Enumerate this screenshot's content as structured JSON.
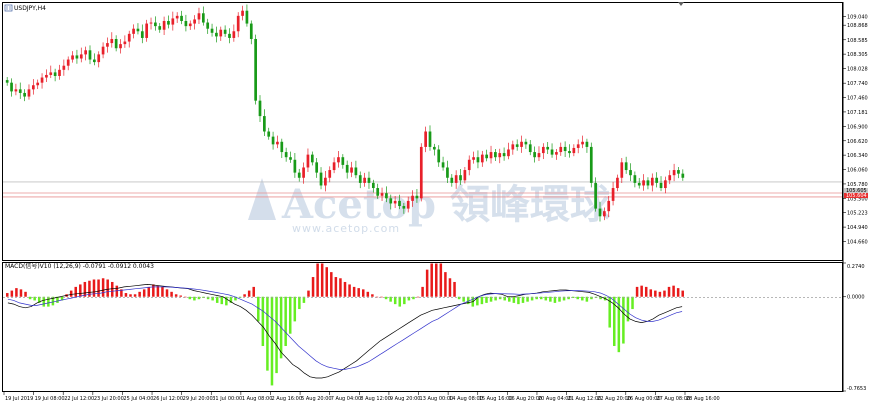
{
  "symbol_label": "USDJPY,H4",
  "macd_label": "MACD(信号)V10 (12,26,9) -0.0791 -0.0912 0.0043",
  "watermark": {
    "brand": "Acetop",
    "cjk": "領峰環球",
    "site": "www.acetop.com"
  },
  "colors": {
    "bull": "#e8202a",
    "bear": "#189a18",
    "hist_pos": "#e81a1a",
    "hist_neg": "#66ee22",
    "macd_line": "#000000",
    "signal_line": "#3333cc",
    "hline": "#e89090",
    "ask_line": "#c0c0c0"
  },
  "price_levels": {
    "bid": "105.604",
    "ask": "105.605"
  },
  "chart_data": [
    {
      "type": "candlestick",
      "title": "USDJPY,H4",
      "ylim": [
        104.3,
        109.3
      ],
      "yticks": [
        "109.040",
        "108.868",
        "108.585",
        "108.305",
        "108.028",
        "107.740",
        "107.460",
        "107.181",
        "106.900",
        "106.620",
        "106.340",
        "106.060",
        "105.780",
        "105.500",
        "105.223",
        "104.940",
        "104.660"
      ],
      "xticks": [
        "19 Jul 2019",
        "19 Jul 08:00",
        "22 Jul 12:00",
        "23 Jul 20:00",
        "25 Jul 04:00",
        "26 Jul 12:00",
        "29 Jul 20:00",
        "31 Jul 00:00",
        "1 Aug 08:00",
        "2 Aug 16:00",
        "5 Aug 20:00",
        "7 Aug 04:00",
        "8 Aug 12:00",
        "9 Aug 20:00",
        "13 Aug 00:00",
        "14 Aug 08:00",
        "15 Aug 16:00",
        "16 Aug 20:00",
        "20 Aug 04:00",
        "21 Aug 12:00",
        "22 Aug 20:00",
        "26 Aug 00:00",
        "27 Aug 08:00",
        "28 Aug 16:00"
      ],
      "hlines": [
        105.604,
        105.605
      ],
      "close": [
        107.75,
        107.58,
        107.62,
        107.55,
        107.48,
        107.62,
        107.7,
        107.75,
        107.85,
        107.9,
        107.95,
        107.88,
        108.0,
        108.08,
        108.2,
        108.28,
        108.22,
        108.3,
        108.38,
        108.2,
        108.15,
        108.3,
        108.45,
        108.52,
        108.6,
        108.42,
        108.5,
        108.55,
        108.7,
        108.8,
        108.75,
        108.62,
        108.9,
        108.92,
        108.85,
        108.78,
        108.95,
        108.88,
        109.0,
        109.05,
        108.95,
        108.85,
        108.9,
        108.98,
        109.1,
        108.92,
        108.8,
        108.72,
        108.65,
        108.78,
        108.7,
        108.62,
        108.75,
        109.05,
        109.15,
        108.9,
        108.6,
        107.4,
        107.1,
        106.8,
        106.7,
        106.55,
        106.6,
        106.4,
        106.3,
        106.25,
        106.0,
        105.9,
        106.1,
        106.35,
        106.2,
        106.0,
        105.75,
        105.9,
        106.05,
        106.2,
        106.3,
        106.15,
        106.0,
        106.1,
        105.95,
        105.8,
        105.9,
        105.8,
        105.7,
        105.55,
        105.6,
        105.5,
        105.4,
        105.45,
        105.35,
        105.3,
        105.45,
        105.55,
        105.5,
        106.5,
        106.8,
        106.5,
        106.45,
        106.2,
        106.1,
        105.9,
        105.8,
        105.95,
        105.85,
        106.05,
        106.25,
        106.3,
        106.2,
        106.35,
        106.28,
        106.4,
        106.3,
        106.38,
        106.32,
        106.45,
        106.55,
        106.5,
        106.6,
        106.55,
        106.4,
        106.3,
        106.38,
        106.5,
        106.45,
        106.35,
        106.4,
        106.5,
        106.42,
        106.38,
        106.48,
        106.55,
        106.6,
        106.5,
        105.8,
        105.3,
        105.15,
        105.25,
        105.45,
        105.7,
        105.9,
        106.2,
        106.05,
        105.95,
        105.8,
        105.75,
        105.85,
        105.75,
        105.9,
        105.8,
        105.7,
        105.85,
        105.95,
        106.05,
        105.98,
        105.9
      ]
    },
    {
      "type": "macd",
      "title": "MACD(信号)V10 (12,26,9) -0.0791 -0.0912 0.0043",
      "ylim": [
        -0.7653,
        0.274
      ],
      "yticks": [
        "0.2740",
        "0.0000",
        "-0.7653"
      ],
      "series": [
        {
          "name": "MACD",
          "values": [
            -0.05,
            -0.06,
            -0.08,
            -0.09,
            -0.08,
            -0.05,
            -0.03,
            -0.02,
            -0.01,
            0.0,
            0.01,
            0.02,
            0.025,
            0.03,
            0.035,
            0.04,
            0.05,
            0.06,
            0.065,
            0.07,
            0.08,
            0.085,
            0.09,
            0.095,
            0.1,
            0.095,
            0.09,
            0.085,
            0.08,
            0.075,
            0.07,
            0.065,
            0.05,
            0.04,
            0.03,
            0.02,
            0.01,
            0.0,
            -0.03,
            -0.06,
            -0.08,
            -0.11,
            -0.15,
            -0.2,
            -0.25,
            -0.32,
            -0.38,
            -0.45,
            -0.5,
            -0.55,
            -0.58,
            -0.62,
            -0.65,
            -0.66,
            -0.66,
            -0.65,
            -0.63,
            -0.61,
            -0.58,
            -0.55,
            -0.52,
            -0.48,
            -0.44,
            -0.4,
            -0.36,
            -0.33,
            -0.3,
            -0.27,
            -0.24,
            -0.21,
            -0.18,
            -0.15,
            -0.13,
            -0.11,
            -0.1,
            -0.09,
            -0.08,
            -0.07,
            -0.06,
            -0.05,
            -0.04,
            0.0,
            0.02,
            0.03,
            0.025,
            0.02,
            0.0,
            0.0,
            0.01,
            0.02,
            0.025,
            0.03,
            0.04,
            0.045,
            0.05,
            0.055,
            0.055,
            0.05,
            0.045,
            0.04,
            0.035,
            0.02,
            0.0,
            -0.02,
            -0.05,
            -0.09,
            -0.14,
            -0.18,
            -0.2,
            -0.21,
            -0.2,
            -0.18,
            -0.15,
            -0.13,
            -0.11,
            -0.09,
            -0.08
          ]
        },
        {
          "name": "Signal",
          "values": [
            -0.02,
            -0.03,
            -0.05,
            -0.06,
            -0.07,
            -0.07,
            -0.06,
            -0.05,
            -0.04,
            -0.03,
            -0.02,
            -0.01,
            0.0,
            0.01,
            0.02,
            0.025,
            0.03,
            0.04,
            0.045,
            0.05,
            0.055,
            0.06,
            0.065,
            0.07,
            0.075,
            0.08,
            0.08,
            0.08,
            0.078,
            0.075,
            0.072,
            0.068,
            0.063,
            0.057,
            0.05,
            0.042,
            0.034,
            0.025,
            0.015,
            0.0,
            -0.02,
            -0.04,
            -0.06,
            -0.09,
            -0.12,
            -0.16,
            -0.2,
            -0.25,
            -0.3,
            -0.35,
            -0.4,
            -0.44,
            -0.48,
            -0.52,
            -0.55,
            -0.57,
            -0.58,
            -0.59,
            -0.59,
            -0.58,
            -0.57,
            -0.55,
            -0.53,
            -0.5,
            -0.47,
            -0.44,
            -0.41,
            -0.38,
            -0.35,
            -0.32,
            -0.29,
            -0.26,
            -0.23,
            -0.2,
            -0.18,
            -0.15,
            -0.12,
            -0.09,
            -0.06,
            -0.04,
            -0.02,
            0.0,
            0.015,
            0.022,
            0.026,
            0.025,
            0.023,
            0.022,
            0.02,
            0.022,
            0.025,
            0.028,
            0.032,
            0.036,
            0.04,
            0.045,
            0.048,
            0.05,
            0.05,
            0.048,
            0.045,
            0.04,
            0.03,
            0.01,
            -0.02,
            -0.06,
            -0.1,
            -0.14,
            -0.17,
            -0.19,
            -0.2,
            -0.2,
            -0.19,
            -0.17,
            -0.15,
            -0.13,
            -0.12
          ]
        }
      ],
      "histogram": [
        0.03,
        0.05,
        0.07,
        0.06,
        0.04,
        -0.02,
        -0.03,
        -0.05,
        -0.08,
        -0.08,
        -0.07,
        -0.05,
        -0.03,
        0.02,
        0.05,
        0.08,
        0.1,
        0.12,
        0.13,
        0.14,
        0.14,
        0.15,
        0.14,
        0.12,
        0.09,
        0.06,
        0.03,
        0.02,
        0.02,
        0.04,
        0.06,
        0.08,
        0.1,
        0.09,
        0.08,
        0.06,
        0.04,
        0.02,
        0.01,
        0.0,
        -0.02,
        -0.03,
        -0.02,
        -0.01,
        -0.02,
        -0.03,
        -0.05,
        -0.06,
        -0.07,
        -0.05,
        -0.03,
        -0.01,
        0.02,
        0.05,
        0.08,
        -0.2,
        -0.4,
        -0.6,
        -0.72,
        -0.62,
        -0.5,
        -0.4,
        -0.3,
        -0.2,
        -0.1,
        -0.05,
        0.05,
        0.16,
        0.27,
        0.27,
        0.24,
        0.2,
        0.16,
        0.15,
        0.12,
        0.1,
        0.08,
        0.07,
        0.06,
        0.04,
        0.02,
        0.0,
        0.0,
        -0.02,
        -0.04,
        -0.06,
        -0.08,
        -0.06,
        -0.03,
        -0.02,
        0.0,
        0.08,
        0.22,
        0.27,
        0.27,
        0.27,
        0.2,
        0.15,
        0.12,
        -0.02,
        -0.04,
        -0.06,
        -0.08,
        -0.07,
        -0.06,
        -0.05,
        -0.04,
        -0.03,
        -0.02,
        -0.03,
        -0.04,
        -0.05,
        -0.06,
        -0.05,
        -0.04,
        -0.03,
        -0.02,
        -0.02,
        -0.03,
        -0.04,
        -0.05,
        -0.04,
        -0.03,
        -0.02,
        -0.01,
        -0.02,
        -0.03,
        -0.04,
        -0.02,
        -0.01,
        -0.02,
        -0.03,
        -0.25,
        -0.4,
        -0.45,
        -0.38,
        -0.2,
        -0.1,
        0.08,
        0.09,
        0.08,
        0.06,
        0.05,
        0.04,
        0.05,
        0.08,
        0.09,
        0.07,
        0.05
      ]
    }
  ]
}
